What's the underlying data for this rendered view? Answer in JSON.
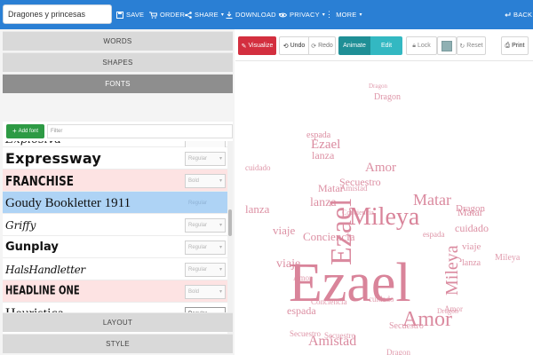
{
  "topbar": {
    "title_value": "Dragones y princesas",
    "items": [
      "SAVE",
      "ORDER",
      "SHARE",
      "DOWNLOAD",
      "PRIVACY",
      "MORE"
    ],
    "back": "BACK"
  },
  "left": {
    "sections": [
      "WORDS",
      "SHAPES",
      "FONTS",
      "LAYOUT",
      "STYLE"
    ],
    "add_font": "Add font",
    "filter_placeholder": "Filter",
    "fonts": [
      {
        "name": "Expressway",
        "style": "Regular",
        "highlight": "none"
      },
      {
        "name": "Franchise",
        "style": "Bold",
        "highlight": "pink"
      },
      {
        "name": "Goudy Bookletter 1911",
        "style": "Regular",
        "highlight": "blue"
      },
      {
        "name": "Griffy",
        "style": "Regular",
        "highlight": "none"
      },
      {
        "name": "Gunplay",
        "style": "Regular",
        "highlight": "none"
      },
      {
        "name": "HalsHandletter",
        "style": "Regular",
        "highlight": "none"
      },
      {
        "name": "HEADLINE ONE",
        "style": "Bold",
        "highlight": "pink"
      },
      {
        "name": "Heuristica",
        "style": "Regular",
        "highlight": "none"
      }
    ]
  },
  "toolbar": {
    "visualize": "Visualize",
    "undo": "Undo",
    "redo": "Redo",
    "animate": "Animate",
    "edit": "Edit",
    "lock": "Lock",
    "reset": "Reset",
    "print": "Print"
  },
  "cloud": {
    "color": "#d9849a",
    "words": [
      "Ezael",
      "Mileya",
      "Amor",
      "Amistad",
      "Matar",
      "Conciencia",
      "Secuestro",
      "Dragon",
      "espada",
      "lanza",
      "viaje",
      "cuidado"
    ]
  }
}
